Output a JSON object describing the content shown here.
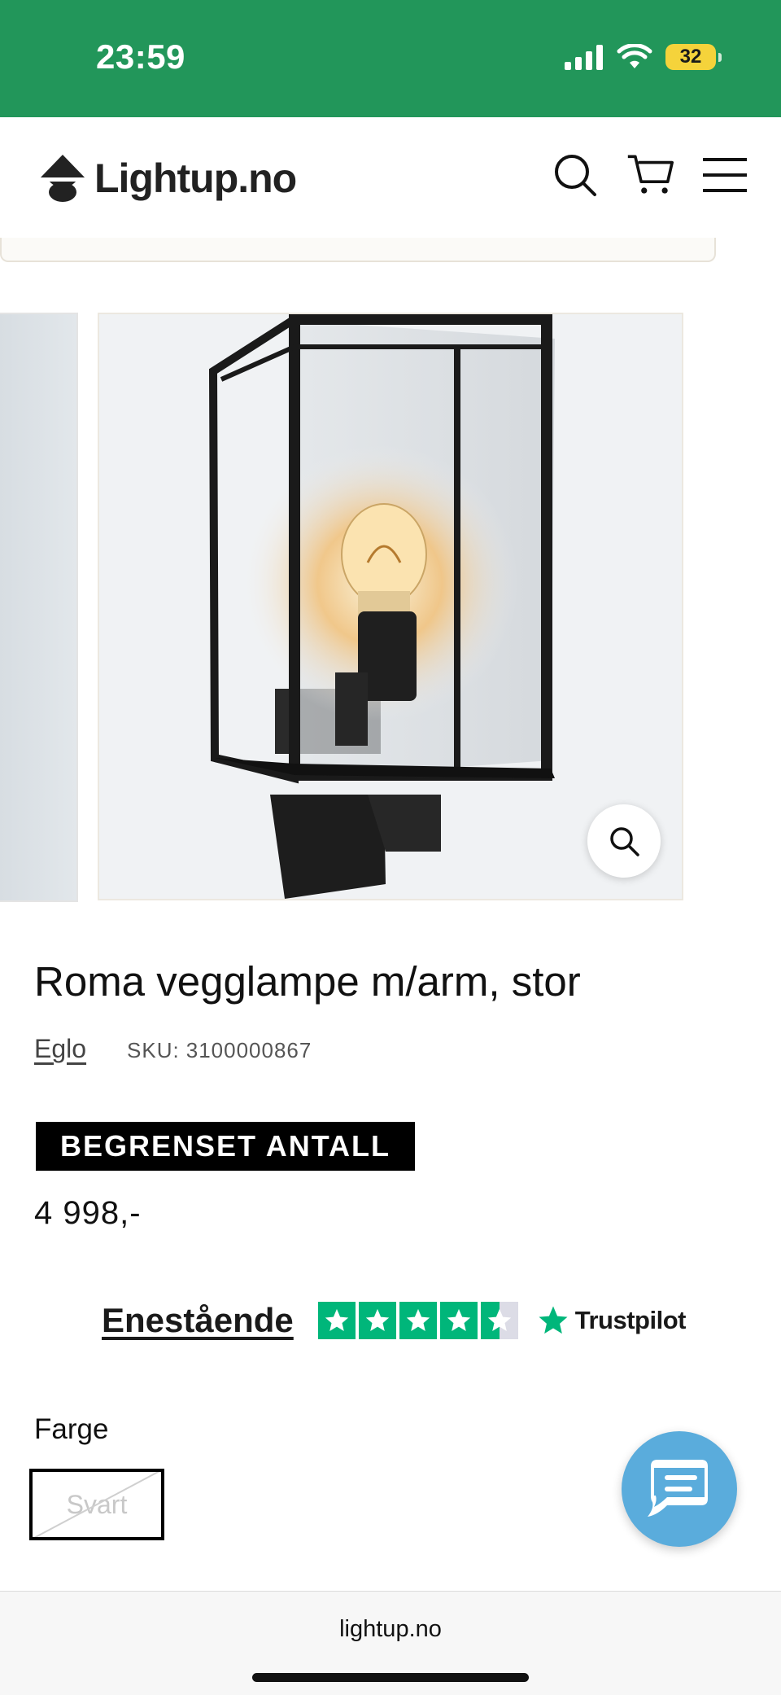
{
  "status_bar": {
    "time": "23:59",
    "battery_level": "32",
    "background_color": "#22965a",
    "icons": [
      "signal-icon",
      "wifi-icon",
      "battery-icon"
    ]
  },
  "header": {
    "logo_text": "Lightup.no",
    "icons": [
      "search-icon",
      "cart-icon",
      "menu-icon"
    ]
  },
  "product": {
    "title": "Roma vegglampe m/arm, stor",
    "vendor": "Eglo",
    "sku_label": "SKU:",
    "sku": "3100000867",
    "badge": "BEGRENSET ANTALL",
    "price": "4 998,-"
  },
  "trustpilot": {
    "rating_text": "Enestående",
    "stars": 4.5,
    "brand": "Trustpilot",
    "brand_color": "#00b67a"
  },
  "options": {
    "label": "Farge",
    "values": [
      "Svart"
    ],
    "selected": "Svart",
    "selected_unavailable": true
  },
  "chat": {
    "icon": "chat-icon",
    "color": "#5aacdc"
  },
  "browser": {
    "url": "lightup.no"
  }
}
